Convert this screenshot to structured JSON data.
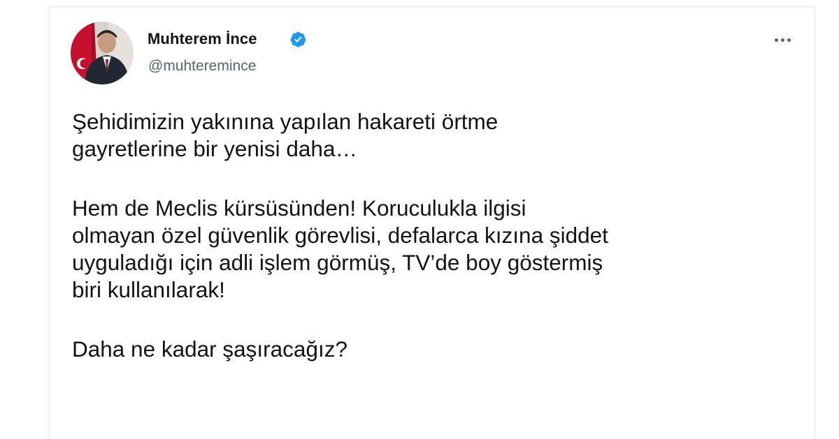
{
  "author": {
    "name": "Muhterem İnce",
    "handle": "@muhteremince",
    "verified": true,
    "verified_color": "#1d9bf0"
  },
  "icons": {
    "avatar": "profile-photo",
    "verified": "verified-badge-icon",
    "more": "more-options-icon"
  },
  "tweet": {
    "paragraph_1": [
      "Şehidimizin yakınına yapılan hakareti örtme",
      "gayretlerine bir yenisi daha…"
    ],
    "paragraph_2": [
      "Hem de Meclis kürsüsünden! Koruculukla ilgisi",
      "olmayan özel güvenlik görevlisi, defalarca kızına şiddet",
      "uyguladığı için adli işlem görmüş, TV’de boy göstermiş",
      "biri kullanılarak!"
    ],
    "paragraph_3": [
      "Daha ne kadar şaşıracağız?"
    ]
  },
  "colors": {
    "text": "#0f1419",
    "secondary_text": "#536471",
    "border": "#dfe3e7"
  }
}
